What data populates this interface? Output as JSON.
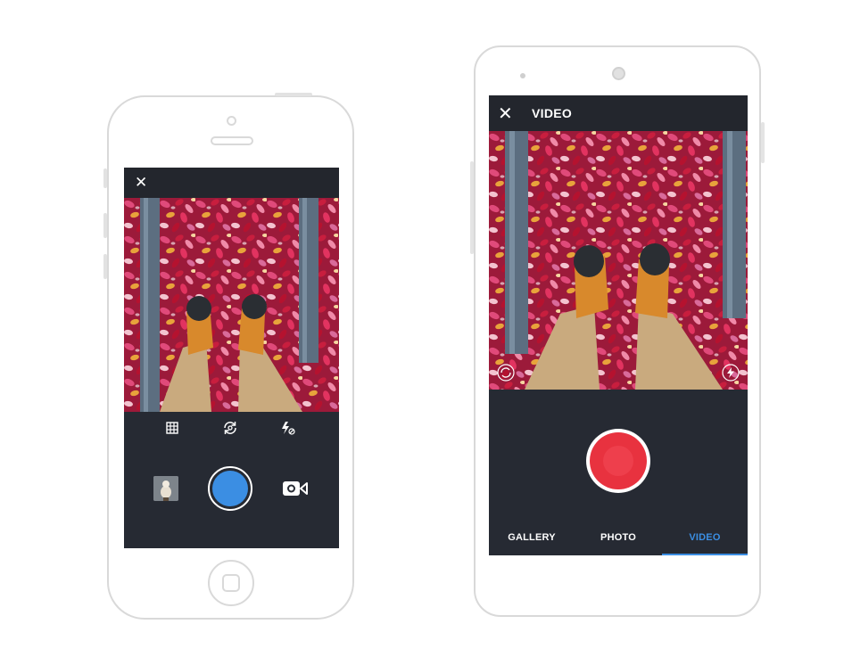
{
  "iphone": {
    "close_glyph": "✕",
    "tools": [
      "grid-icon",
      "switch-camera-icon",
      "flash-off-icon"
    ],
    "mode_icon": "video-camera-icon",
    "shutter_color": "#3b8ee3"
  },
  "android": {
    "close_glyph": "✕",
    "title": "VIDEO",
    "tabs": [
      {
        "label": "GALLERY",
        "active": false
      },
      {
        "label": "PHOTO",
        "active": false
      },
      {
        "label": "VIDEO",
        "active": true
      }
    ],
    "record_color": "#e8323f",
    "active_tab_color": "#3b8ee3"
  }
}
